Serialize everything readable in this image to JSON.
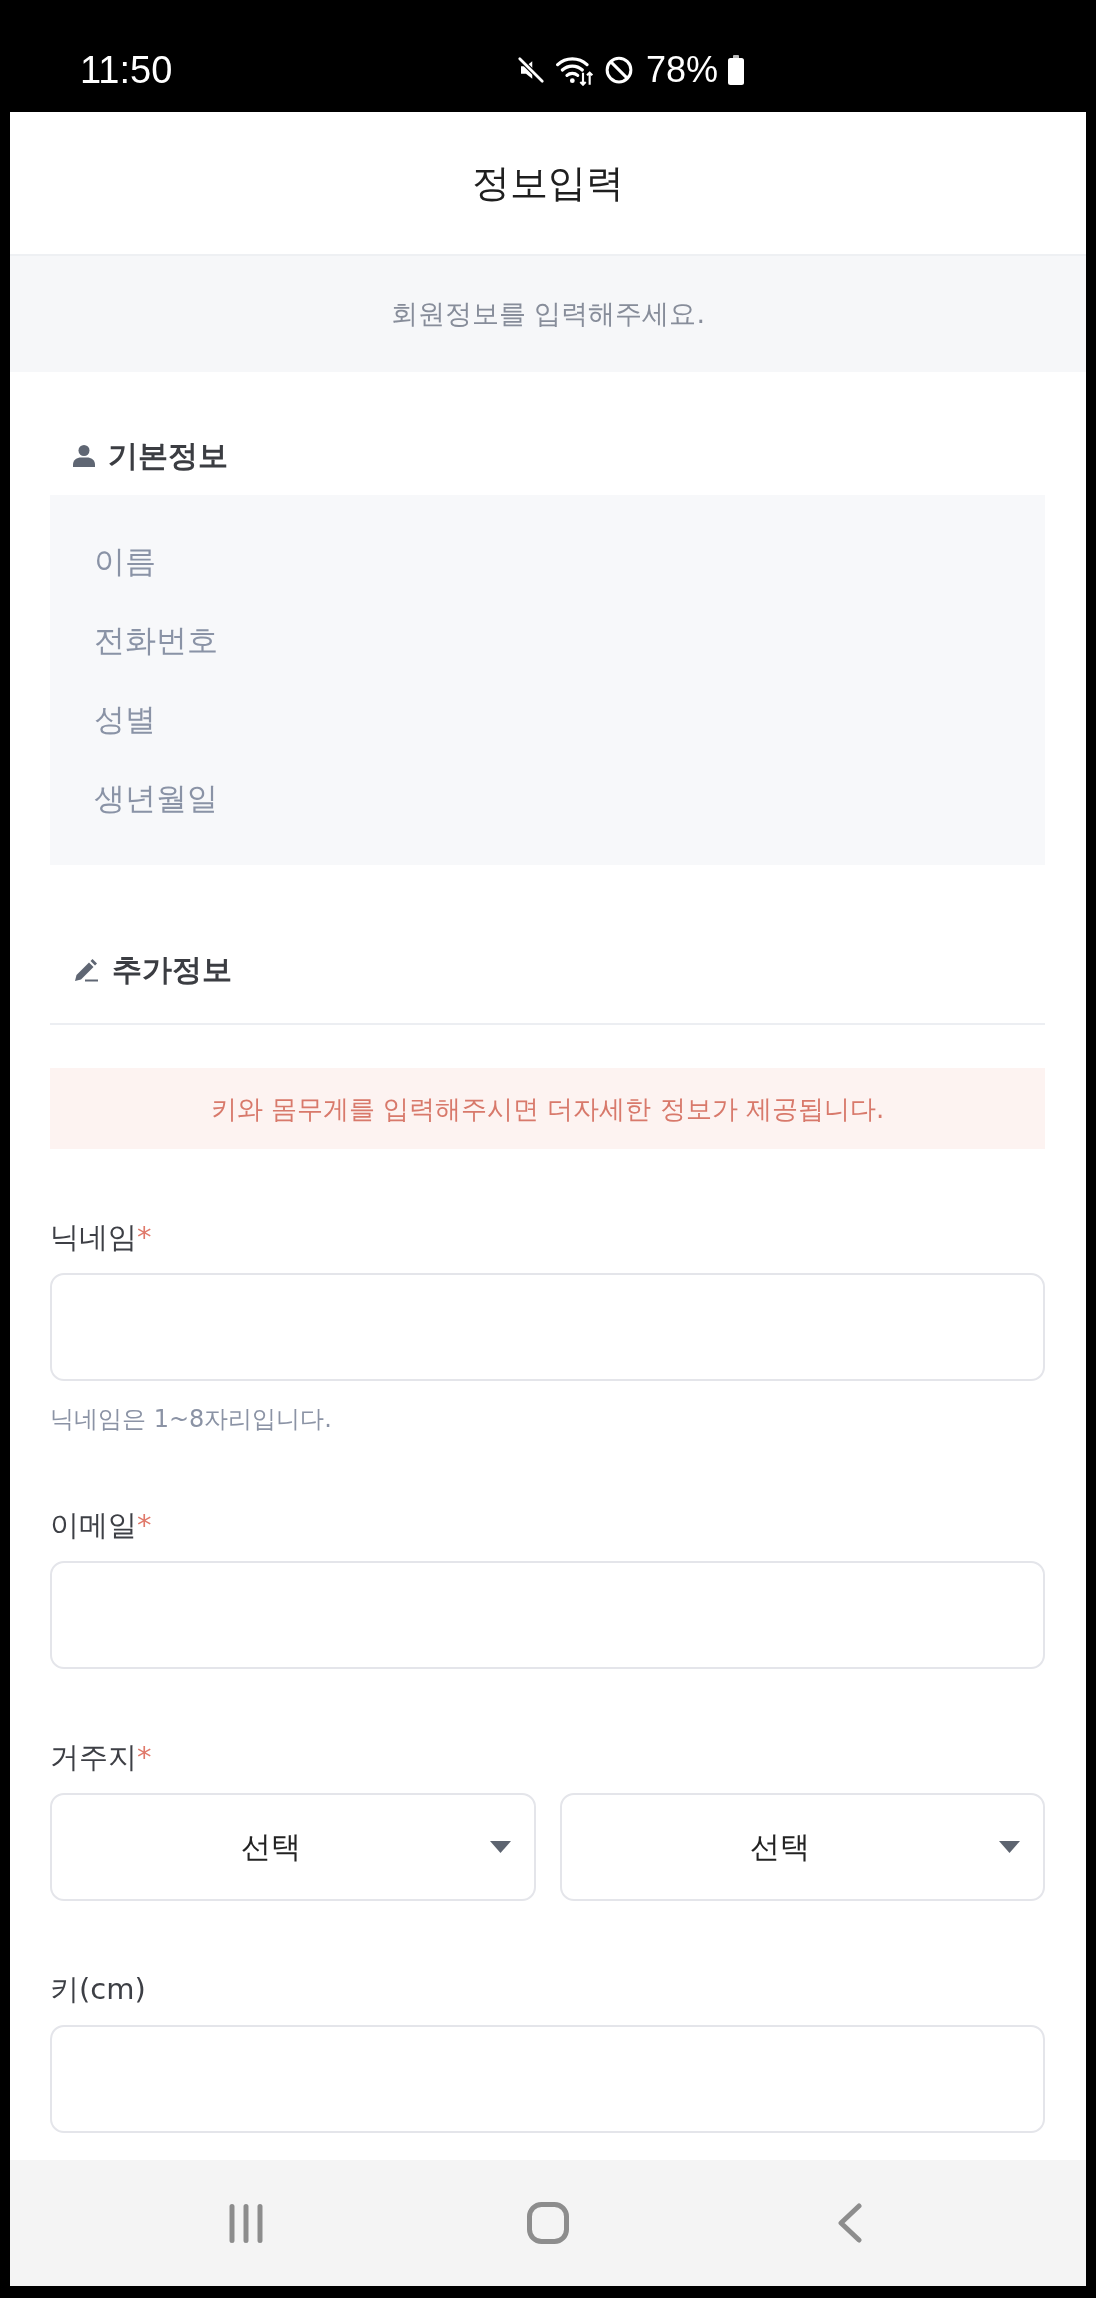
{
  "status_bar": {
    "time": "11:50",
    "battery": "78%"
  },
  "header": {
    "title": "정보입력"
  },
  "intro": {
    "text": "회원정보를 입력해주세요."
  },
  "basic_info": {
    "title": "기본정보",
    "items": [
      "이름",
      "전화번호",
      "성별",
      "생년월일"
    ]
  },
  "additional_info": {
    "title": "추가정보",
    "notice": "키와 몸무게를 입력해주시면 더자세한 정보가 제공됩니다.",
    "fields": [
      {
        "kind": "text",
        "label": "닉네임",
        "required_mark": "*",
        "hint": "닉네임은 1~8자리입니다."
      },
      {
        "kind": "text",
        "label": "이메일",
        "required_mark": "*"
      },
      {
        "kind": "select",
        "label": "거주지",
        "required_mark": "*",
        "selects": [
          {
            "value": "선택"
          },
          {
            "value": "선택"
          }
        ]
      },
      {
        "kind": "text",
        "label": "키(cm)"
      }
    ]
  }
}
